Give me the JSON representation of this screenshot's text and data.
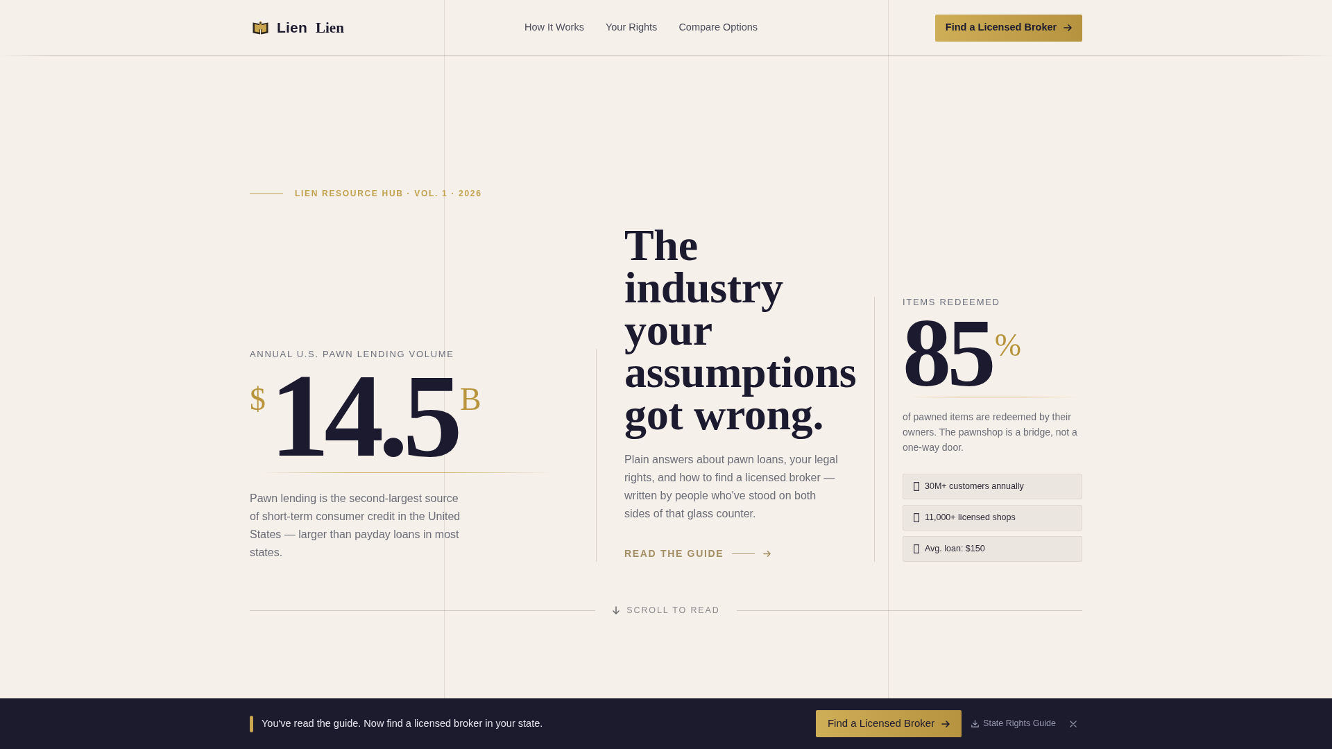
{
  "header": {
    "logo": {
      "sans_text": "Lien",
      "serif_text": "Lien"
    },
    "nav": [
      {
        "label": "How It Works"
      },
      {
        "label": "Your Rights"
      },
      {
        "label": "Compare Options"
      }
    ],
    "cta": "Find a Licensed Broker"
  },
  "eyebrow": "LIEN RESOURCE HUB · VOL. 1 · 2026",
  "volume_stat": {
    "label": "ANNUAL U.S. PAWN LENDING VOLUME",
    "prefix": "$",
    "value": "14.5",
    "suffix": "B",
    "description": "Pawn lending is the second-largest source of short-term consumer credit in the United States — larger than payday loans in most states."
  },
  "intro": {
    "headline": "The industry your assumptions got wrong.",
    "body": "Plain answers about pawn loans, your legal rights, and how to find a licensed broker — written by people who've stood on both sides of that glass counter.",
    "link": "READ THE GUIDE"
  },
  "redemption_stat": {
    "label": "ITEMS REDEEMED",
    "value": "85",
    "suffix": "%",
    "description": "of pawned items are redeemed by their owners. The pawnshop is a bridge, not a one-way door.",
    "facts": [
      {
        "text": "30M+ customers annually"
      },
      {
        "text": "11,000+ licensed shops"
      },
      {
        "text": "Avg. loan: $150"
      }
    ]
  },
  "scroll_hint": "SCROLL TO READ",
  "sticky_bar": {
    "message": "You've read the guide. Now find a licensed broker in your state.",
    "cta": "Find a Licensed Broker",
    "secondary_link": "State Rights Guide"
  }
}
